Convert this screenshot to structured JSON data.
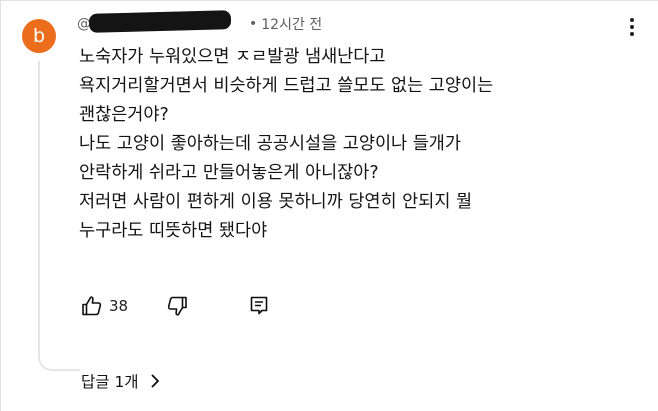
{
  "comment": {
    "avatar_letter": "b",
    "avatar_color": "#ec6e1d",
    "author_handle": "@",
    "time_ago": "12시간 전",
    "separator": "•",
    "lines": [
      "노숙자가 누워있으면 ㅈㄹ발광 냄새난다고",
      "욕지거리할거면서 비슷하게 드럽고 쓸모도 없는 고양이는",
      "괜찮은거야?",
      "나도 고양이 좋아하는데 공공시설을 고양이나 들개가",
      "안락하게 쉬라고 만들어놓은게 아니잖아?",
      "저러면 사람이 편하게 이용 못하니까 당연히 안되지 뭘",
      "누구라도 띠뜻하면 됐다야"
    ]
  },
  "actions": {
    "like_count": "38",
    "like_icon": "thumbs-up-icon",
    "dislike_icon": "thumbs-down-icon",
    "reply_icon": "reply-comment-icon"
  },
  "replies": {
    "label": "답글 1개",
    "chevron_icon": "chevron-right-icon"
  },
  "menu_icon": "more-vertical-icon"
}
